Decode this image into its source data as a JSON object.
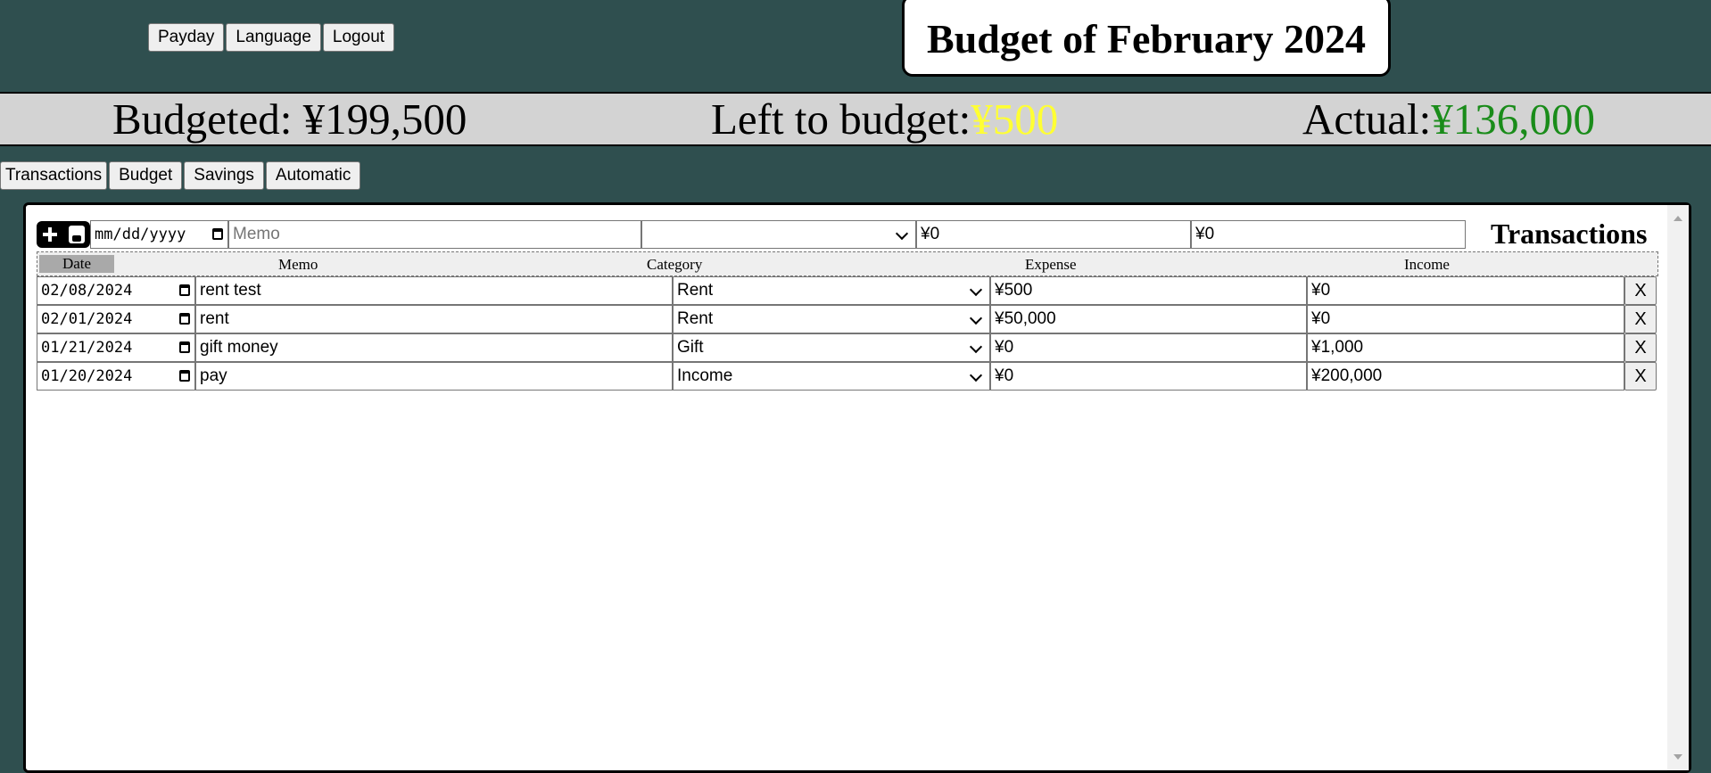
{
  "top_nav": {
    "payday_label": "Payday",
    "language_label": "Language",
    "logout_label": "Logout"
  },
  "title": "Budget of February 2024",
  "summary": {
    "budgeted_label": "Budgeted:",
    "budgeted_value": "¥199,500",
    "left_label": "Left to budget:",
    "left_value": "¥500",
    "left_color": "#ffff33",
    "actual_label": "Actual:",
    "actual_value": "¥136,000",
    "actual_color": "#1a8c1a"
  },
  "tabs": [
    "Transactions",
    "Budget",
    "Savings",
    "Automatic"
  ],
  "panel": {
    "title": "Transactions",
    "entry": {
      "add_icon": "plus-icon",
      "save_icon": "floppy-disk-icon",
      "date_placeholder": "mm/dd/yyyy",
      "memo_placeholder": "Memo",
      "category_value": "",
      "expense_value": "¥0",
      "income_value": "¥0"
    },
    "columns": [
      "Date",
      "Memo",
      "Category",
      "Expense",
      "Income"
    ],
    "rows": [
      {
        "date": "02/08/2024",
        "memo": "rent test",
        "category": "Rent",
        "expense": "¥500",
        "income": "¥0",
        "delete": "X"
      },
      {
        "date": "02/01/2024",
        "memo": "rent",
        "category": "Rent",
        "expense": "¥50,000",
        "income": "¥0",
        "delete": "X"
      },
      {
        "date": "01/21/2024",
        "memo": "gift money",
        "category": "Gift",
        "expense": "¥0",
        "income": "¥1,000",
        "delete": "X"
      },
      {
        "date": "01/20/2024",
        "memo": "pay",
        "category": "Income",
        "expense": "¥0",
        "income": "¥200,000",
        "delete": "X"
      }
    ]
  }
}
